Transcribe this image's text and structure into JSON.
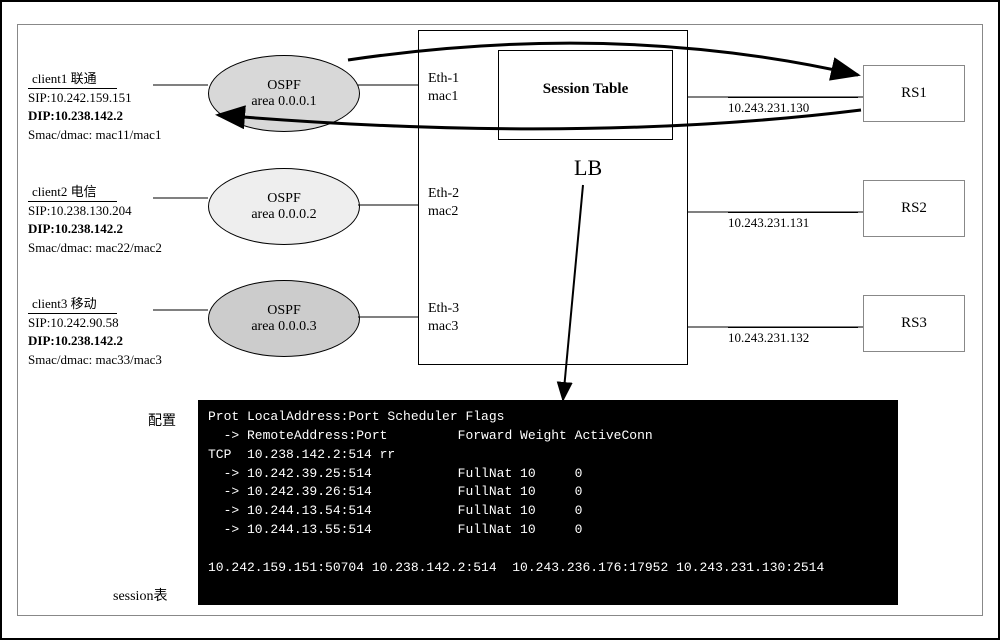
{
  "clients": [
    {
      "name": "client1 联通",
      "sip": "SIP:10.242.159.151",
      "dip": "DIP:10.238.142.2",
      "mac": "Smac/dmac: mac11/mac1"
    },
    {
      "name": "client2 电信",
      "sip": "SIP:10.238.130.204",
      "dip": "DIP:10.238.142.2",
      "mac": "Smac/dmac: mac22/mac2"
    },
    {
      "name": "client3 移动",
      "sip": "SIP:10.242.90.58",
      "dip": "DIP:10.238.142.2",
      "mac": "Smac/dmac: mac33/mac3"
    }
  ],
  "ospf": [
    {
      "title": "OSPF",
      "area": "area 0.0.0.1"
    },
    {
      "title": "OSPF",
      "area": "area 0.0.0.2"
    },
    {
      "title": "OSPF",
      "area": "area 0.0.0.3"
    }
  ],
  "lb": {
    "eth1": "Eth-1\nmac1",
    "eth2": "Eth-2\nmac2",
    "eth3": "Eth-3\nmac3",
    "session_title": "Session Table",
    "label": "LB"
  },
  "rs": [
    {
      "name": "RS1",
      "ip": "10.243.231.130"
    },
    {
      "name": "RS2",
      "ip": "10.243.231.131"
    },
    {
      "name": "RS3",
      "ip": "10.243.231.132"
    }
  ],
  "config_label": "配置",
  "session_label": "session表",
  "terminal": {
    "line1": "Prot LocalAddress:Port Scheduler Flags",
    "line2": "  -> RemoteAddress:Port         Forward Weight ActiveConn",
    "line3": "TCP  10.238.142.2:514 rr",
    "line4": "  -> 10.242.39.25:514           FullNat 10     0",
    "line5": "  -> 10.242.39.26:514           FullNat 10     0",
    "line6": "  -> 10.244.13.54:514           FullNat 10     0",
    "line7": "  -> 10.244.13.55:514           FullNat 10     0",
    "line8": "10.242.159.151:50704 10.238.142.2:514  10.243.236.176:17952 10.243.231.130:2514"
  }
}
